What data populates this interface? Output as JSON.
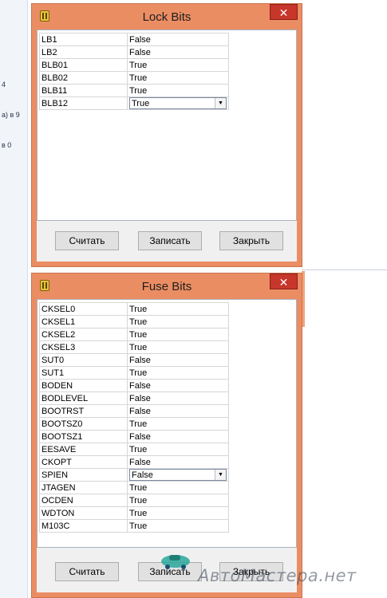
{
  "background_page": {
    "fragments": [
      "4",
      "а) в 9",
      "в 0"
    ]
  },
  "lock_window": {
    "title": "Lock Bits",
    "close_glyph": "✕",
    "rows": [
      {
        "name": "LB1",
        "value": "False"
      },
      {
        "name": "LB2",
        "value": "False"
      },
      {
        "name": "BLB01",
        "value": "True"
      },
      {
        "name": "BLB02",
        "value": "True"
      },
      {
        "name": "BLB11",
        "value": "True"
      },
      {
        "name": "BLB12",
        "value": "True",
        "dropdown": true
      }
    ],
    "buttons": {
      "read": "Считать",
      "write": "Записать",
      "close": "Закрыть"
    }
  },
  "fuse_window": {
    "title": "Fuse Bits",
    "close_glyph": "✕",
    "rows": [
      {
        "name": "CKSEL0",
        "value": "True"
      },
      {
        "name": "CKSEL1",
        "value": "True"
      },
      {
        "name": "CKSEL2",
        "value": "True"
      },
      {
        "name": "CKSEL3",
        "value": "True"
      },
      {
        "name": "SUT0",
        "value": "False"
      },
      {
        "name": "SUT1",
        "value": "True"
      },
      {
        "name": "BODEN",
        "value": "False"
      },
      {
        "name": "BODLEVEL",
        "value": "False"
      },
      {
        "name": "BOOTRST",
        "value": "False"
      },
      {
        "name": "BOOTSZ0",
        "value": "True"
      },
      {
        "name": "BOOTSZ1",
        "value": "False"
      },
      {
        "name": "EESAVE",
        "value": "True"
      },
      {
        "name": "CKOPT",
        "value": "False"
      },
      {
        "name": "SPIEN",
        "value": "False",
        "dropdown": true
      },
      {
        "name": "JTAGEN",
        "value": "True"
      },
      {
        "name": "OCDEN",
        "value": "True"
      },
      {
        "name": "WDTON",
        "value": "True"
      },
      {
        "name": "M103C",
        "value": "True"
      }
    ],
    "buttons": {
      "read": "Считать",
      "write": "Записать",
      "close": "Закрыть"
    }
  },
  "watermark": {
    "text": "АвтоМастера.нет"
  },
  "colors": {
    "title_bar": "#eb8d63",
    "close_button": "#c7362b",
    "client_area": "#f0f0f0"
  }
}
